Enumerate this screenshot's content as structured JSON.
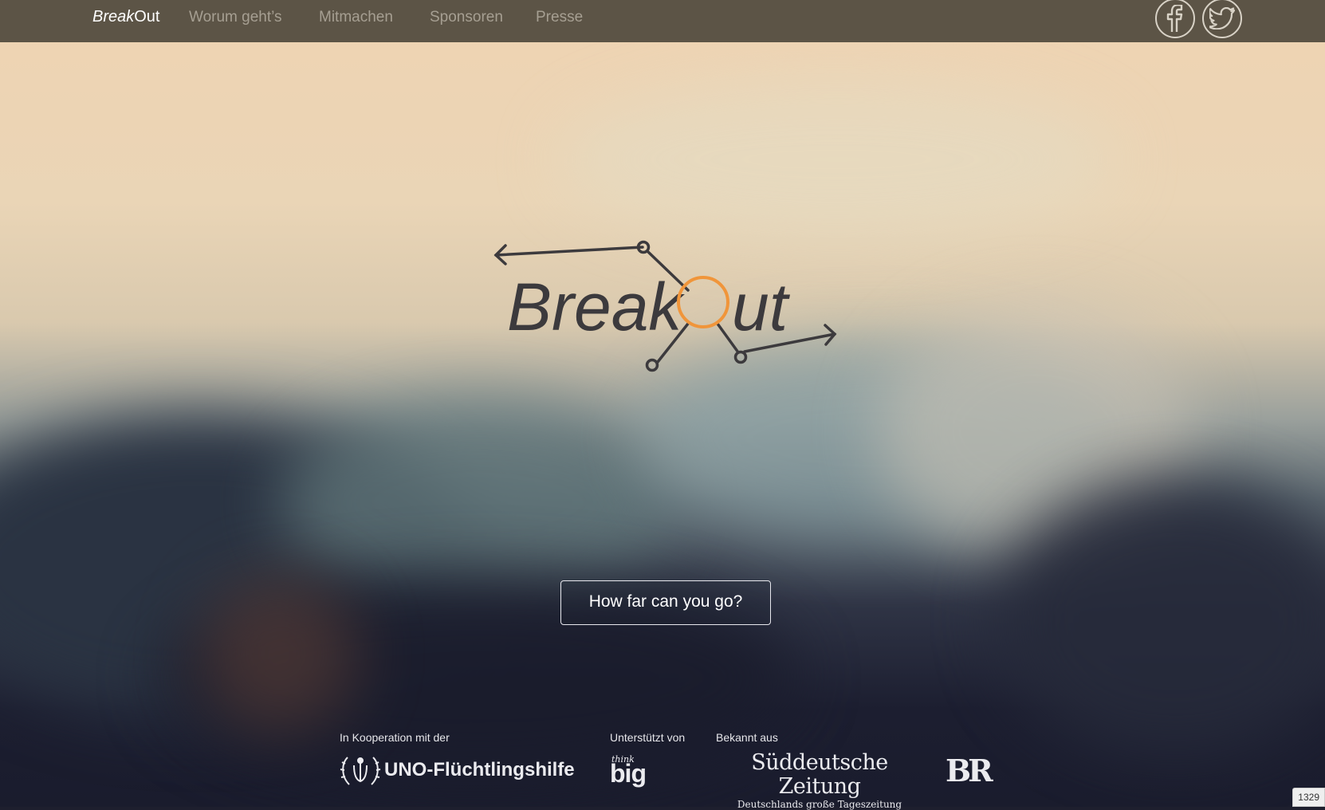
{
  "nav": {
    "brand_italic": "Break",
    "brand_regular": "Out",
    "links": [
      "Worum geht’s",
      "Mitmachen",
      "Sponsoren",
      "Presse"
    ],
    "social": [
      {
        "icon": "facebook-icon"
      },
      {
        "icon": "twitter-icon"
      }
    ]
  },
  "hero": {
    "logo_text_left": "Break",
    "logo_text_right": "ut",
    "accent_color": "#f0953a",
    "cta_label": "How far can you go?"
  },
  "partners": {
    "cooperation_label": "In Kooperation mit der",
    "cooperation_name": "UNO-Flüchtlingshilfe",
    "supported_label": "Unterstützt von",
    "supported_name_small": "think",
    "supported_name_big": "big",
    "known_label": "Bekannt aus",
    "press_name": "Süddeutsche Zeitung",
    "press_tagline": "Deutschlands große Tageszeitung",
    "press_name_2": "BR"
  },
  "corner_badge": "1329"
}
